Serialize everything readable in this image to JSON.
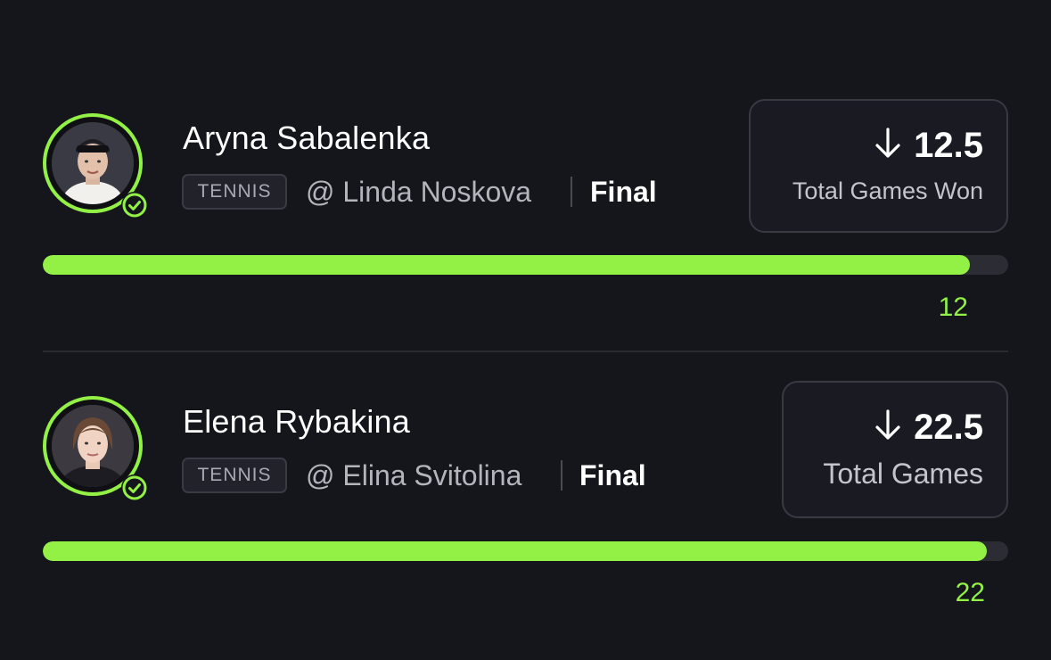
{
  "picks": [
    {
      "player": "Aryna Sabalenka",
      "sport_tag": "TENNIS",
      "opponent": "@ Linda Noskova",
      "status": "Final",
      "direction_icon": "arrow-down-icon",
      "line_value": "12.5",
      "stat_label": "Total Games Won",
      "current_value": "12",
      "progress_fraction": 0.96,
      "verified_icon": "check-circle-icon"
    },
    {
      "player": "Elena Rybakina",
      "sport_tag": "TENNIS",
      "opponent": "@ Elina Svitolina",
      "status": "Final",
      "direction_icon": "arrow-down-icon",
      "line_value": "22.5",
      "stat_label": "Total Games",
      "current_value": "22",
      "progress_fraction": 0.978,
      "verified_icon": "check-circle-icon"
    }
  ],
  "colors": {
    "background": "#15151c",
    "accent": "#93f146",
    "track": "#2c2c35",
    "card_border": "#393943"
  }
}
